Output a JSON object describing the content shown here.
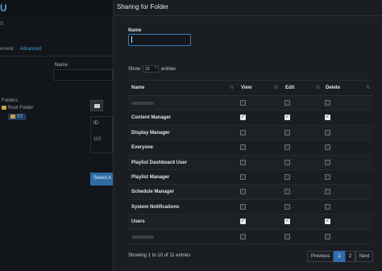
{
  "background": {
    "logo": "U",
    "sub": "S",
    "tabs": [
      "eneral",
      "Advanced"
    ],
    "name_label": "Name",
    "folders_label": "Folders",
    "root_folder": "Root Folder",
    "selected_folder": "ST",
    "id_label": "ID",
    "id_value": "110",
    "select_button": "Select A"
  },
  "modal": {
    "title": "Sharing for Folder",
    "name_label": "Name",
    "name_value": "",
    "show_label": "Show",
    "show_value": "10",
    "entries_label": "entries",
    "columns": [
      "Name",
      "View",
      "Edit",
      "Delete"
    ],
    "rows": [
      {
        "name": "",
        "view": false,
        "edit": false,
        "delete": false
      },
      {
        "name": "Content Manager",
        "view": true,
        "edit": true,
        "delete": true
      },
      {
        "name": "Display Manager",
        "view": false,
        "edit": false,
        "delete": false
      },
      {
        "name": "Everyone",
        "view": false,
        "edit": false,
        "delete": false
      },
      {
        "name": "Playlist Dashboard User",
        "view": false,
        "edit": false,
        "delete": false
      },
      {
        "name": "Playlist Manager",
        "view": false,
        "edit": false,
        "delete": false
      },
      {
        "name": "Schedule Manager",
        "view": false,
        "edit": false,
        "delete": false
      },
      {
        "name": "System Notifications",
        "view": false,
        "edit": false,
        "delete": false
      },
      {
        "name": "Users",
        "view": true,
        "edit": true,
        "delete": true
      },
      {
        "name": "",
        "view": false,
        "edit": false,
        "delete": false
      }
    ],
    "info": "Showing 1 to 10 of 11 entries",
    "pager": {
      "previous": "Previous",
      "page1": "1",
      "page2": "2",
      "next": "Next"
    }
  }
}
